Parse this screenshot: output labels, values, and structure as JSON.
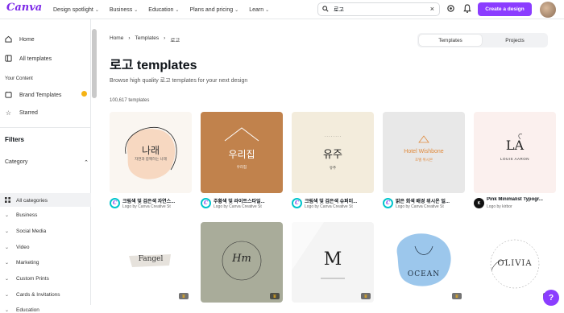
{
  "app": {
    "logo": "Canva"
  },
  "nav": [
    {
      "label": "Design spotlight"
    },
    {
      "label": "Business"
    },
    {
      "label": "Education"
    },
    {
      "label": "Plans and pricing"
    },
    {
      "label": "Learn"
    }
  ],
  "search": {
    "value": "로고",
    "icon": "search-icon"
  },
  "top_actions": {
    "create_label": "Create a design",
    "icons": [
      "gear-icon",
      "bell-icon"
    ]
  },
  "sidebar": {
    "items": [
      {
        "label": "Home",
        "icon": "home-icon"
      },
      {
        "label": "All templates",
        "icon": "templates-icon"
      }
    ],
    "section_label": "Your Content",
    "content_items": [
      {
        "label": "Brand Templates",
        "icon": "brand-icon"
      },
      {
        "label": "Starred",
        "icon": "star-icon"
      }
    ],
    "filters_heading": "Filters",
    "category_heading": "Category",
    "categories": [
      {
        "label": "All categories",
        "active": true
      },
      {
        "label": "Business"
      },
      {
        "label": "Social Media"
      },
      {
        "label": "Video"
      },
      {
        "label": "Marketing"
      },
      {
        "label": "Custom Prints"
      },
      {
        "label": "Cards & Invitations"
      },
      {
        "label": "Education"
      }
    ]
  },
  "breadcrumb": {
    "home": "Home",
    "sep": "›",
    "templates": "Templates",
    "current": "로고"
  },
  "tabs": {
    "templates": "Templates",
    "projects": "Projects"
  },
  "page": {
    "title": "로고 templates",
    "subtitle": "Browse high quality 로고 templates for your next design",
    "count": "100,617 templates"
  },
  "templates": [
    {
      "title": "크림색 및 검은색 자연스...",
      "author": "Logo by Canva Creative St",
      "thumb_text": "나래",
      "thumb_sub": "자연과 함께하는 나래",
      "premium": false
    },
    {
      "title": "주황색 및 라이트스타일...",
      "author": "Logo by Canva Creative St",
      "thumb_text": "우리집",
      "thumb_sub": "우리집",
      "premium": false
    },
    {
      "title": "크림색 및 검은색 슈퍼미...",
      "author": "Logo by Canva Creative St",
      "thumb_text": "유주",
      "thumb_sub": "유주",
      "premium": false
    },
    {
      "title": "밝은 회색 배경 위시온 일...",
      "author": "Logo by Canva Creative St",
      "thumb_text": "Hotel Wishbone",
      "thumb_sub": "호텔 위시본",
      "premium": false
    },
    {
      "title": "Pink Minimalist Typogr...",
      "author": "Logo by kirbor",
      "thumb_text": "LA",
      "thumb_sub": "LOUIS AARON",
      "premium": false
    },
    {
      "title": "",
      "author": "",
      "thumb_text": "Fangel",
      "thumb_sub": "",
      "premium": true
    },
    {
      "title": "",
      "author": "",
      "thumb_text": "Hm",
      "thumb_sub": "",
      "premium": true
    },
    {
      "title": "",
      "author": "",
      "thumb_text": "M",
      "thumb_sub": "",
      "premium": true
    },
    {
      "title": "",
      "author": "",
      "thumb_text": "OCEAN",
      "thumb_sub": "",
      "premium": true
    },
    {
      "title": "",
      "author": "",
      "thumb_text": "OLIVIA",
      "thumb_sub": "",
      "premium": true
    }
  ],
  "colors": {
    "accent": "#8b3dff",
    "create_button": "#8b3dff",
    "badge": "#f5b315"
  }
}
